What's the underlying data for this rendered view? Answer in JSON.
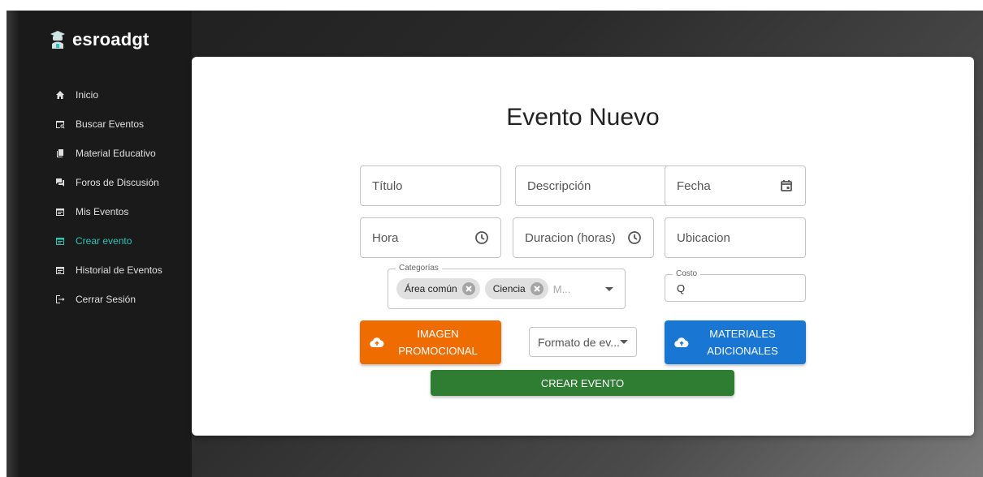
{
  "brand": {
    "name": "esroadgt"
  },
  "sidebar": {
    "items": [
      {
        "label": "Inicio",
        "icon": "home-icon",
        "active": false
      },
      {
        "label": "Buscar Eventos",
        "icon": "calendar-search-icon",
        "active": false
      },
      {
        "label": "Material Educativo",
        "icon": "book-icon",
        "active": false
      },
      {
        "label": "Foros de Discusión",
        "icon": "forum-icon",
        "active": false
      },
      {
        "label": "Mis Eventos",
        "icon": "calendar-icon",
        "active": false
      },
      {
        "label": "Crear evento",
        "icon": "calendar-icon",
        "active": true
      },
      {
        "label": "Historial de Eventos",
        "icon": "calendar-icon",
        "active": false
      },
      {
        "label": "Cerrar Sesión",
        "icon": "logout-icon",
        "active": false
      }
    ]
  },
  "form": {
    "title": "Evento Nuevo",
    "titulo_placeholder": "Título",
    "descripcion_placeholder": "Descripción",
    "fecha_placeholder": "Fecha",
    "hora_placeholder": "Hora",
    "duracion_placeholder": "Duracion (horas)",
    "ubicacion_placeholder": "Ubicacion",
    "categorias_label": "Categorías",
    "categorias_chips": [
      "Área común",
      "Ciencia"
    ],
    "categorias_overflow": "M...",
    "costo_label": "Costo",
    "costo_value": "Q",
    "formato_placeholder": "Formato de ev...",
    "imagen_button": [
      "IMAGEN",
      "PROMOCIONAL"
    ],
    "materiales_button": [
      "MATERIALES",
      "ADICIONALES"
    ],
    "crear_button": "CREAR EVENTO"
  },
  "colors": {
    "accent_active": "#2ec4b6",
    "orange": "#ef6c00",
    "blue": "#1976d2",
    "green": "#2e7d32"
  }
}
